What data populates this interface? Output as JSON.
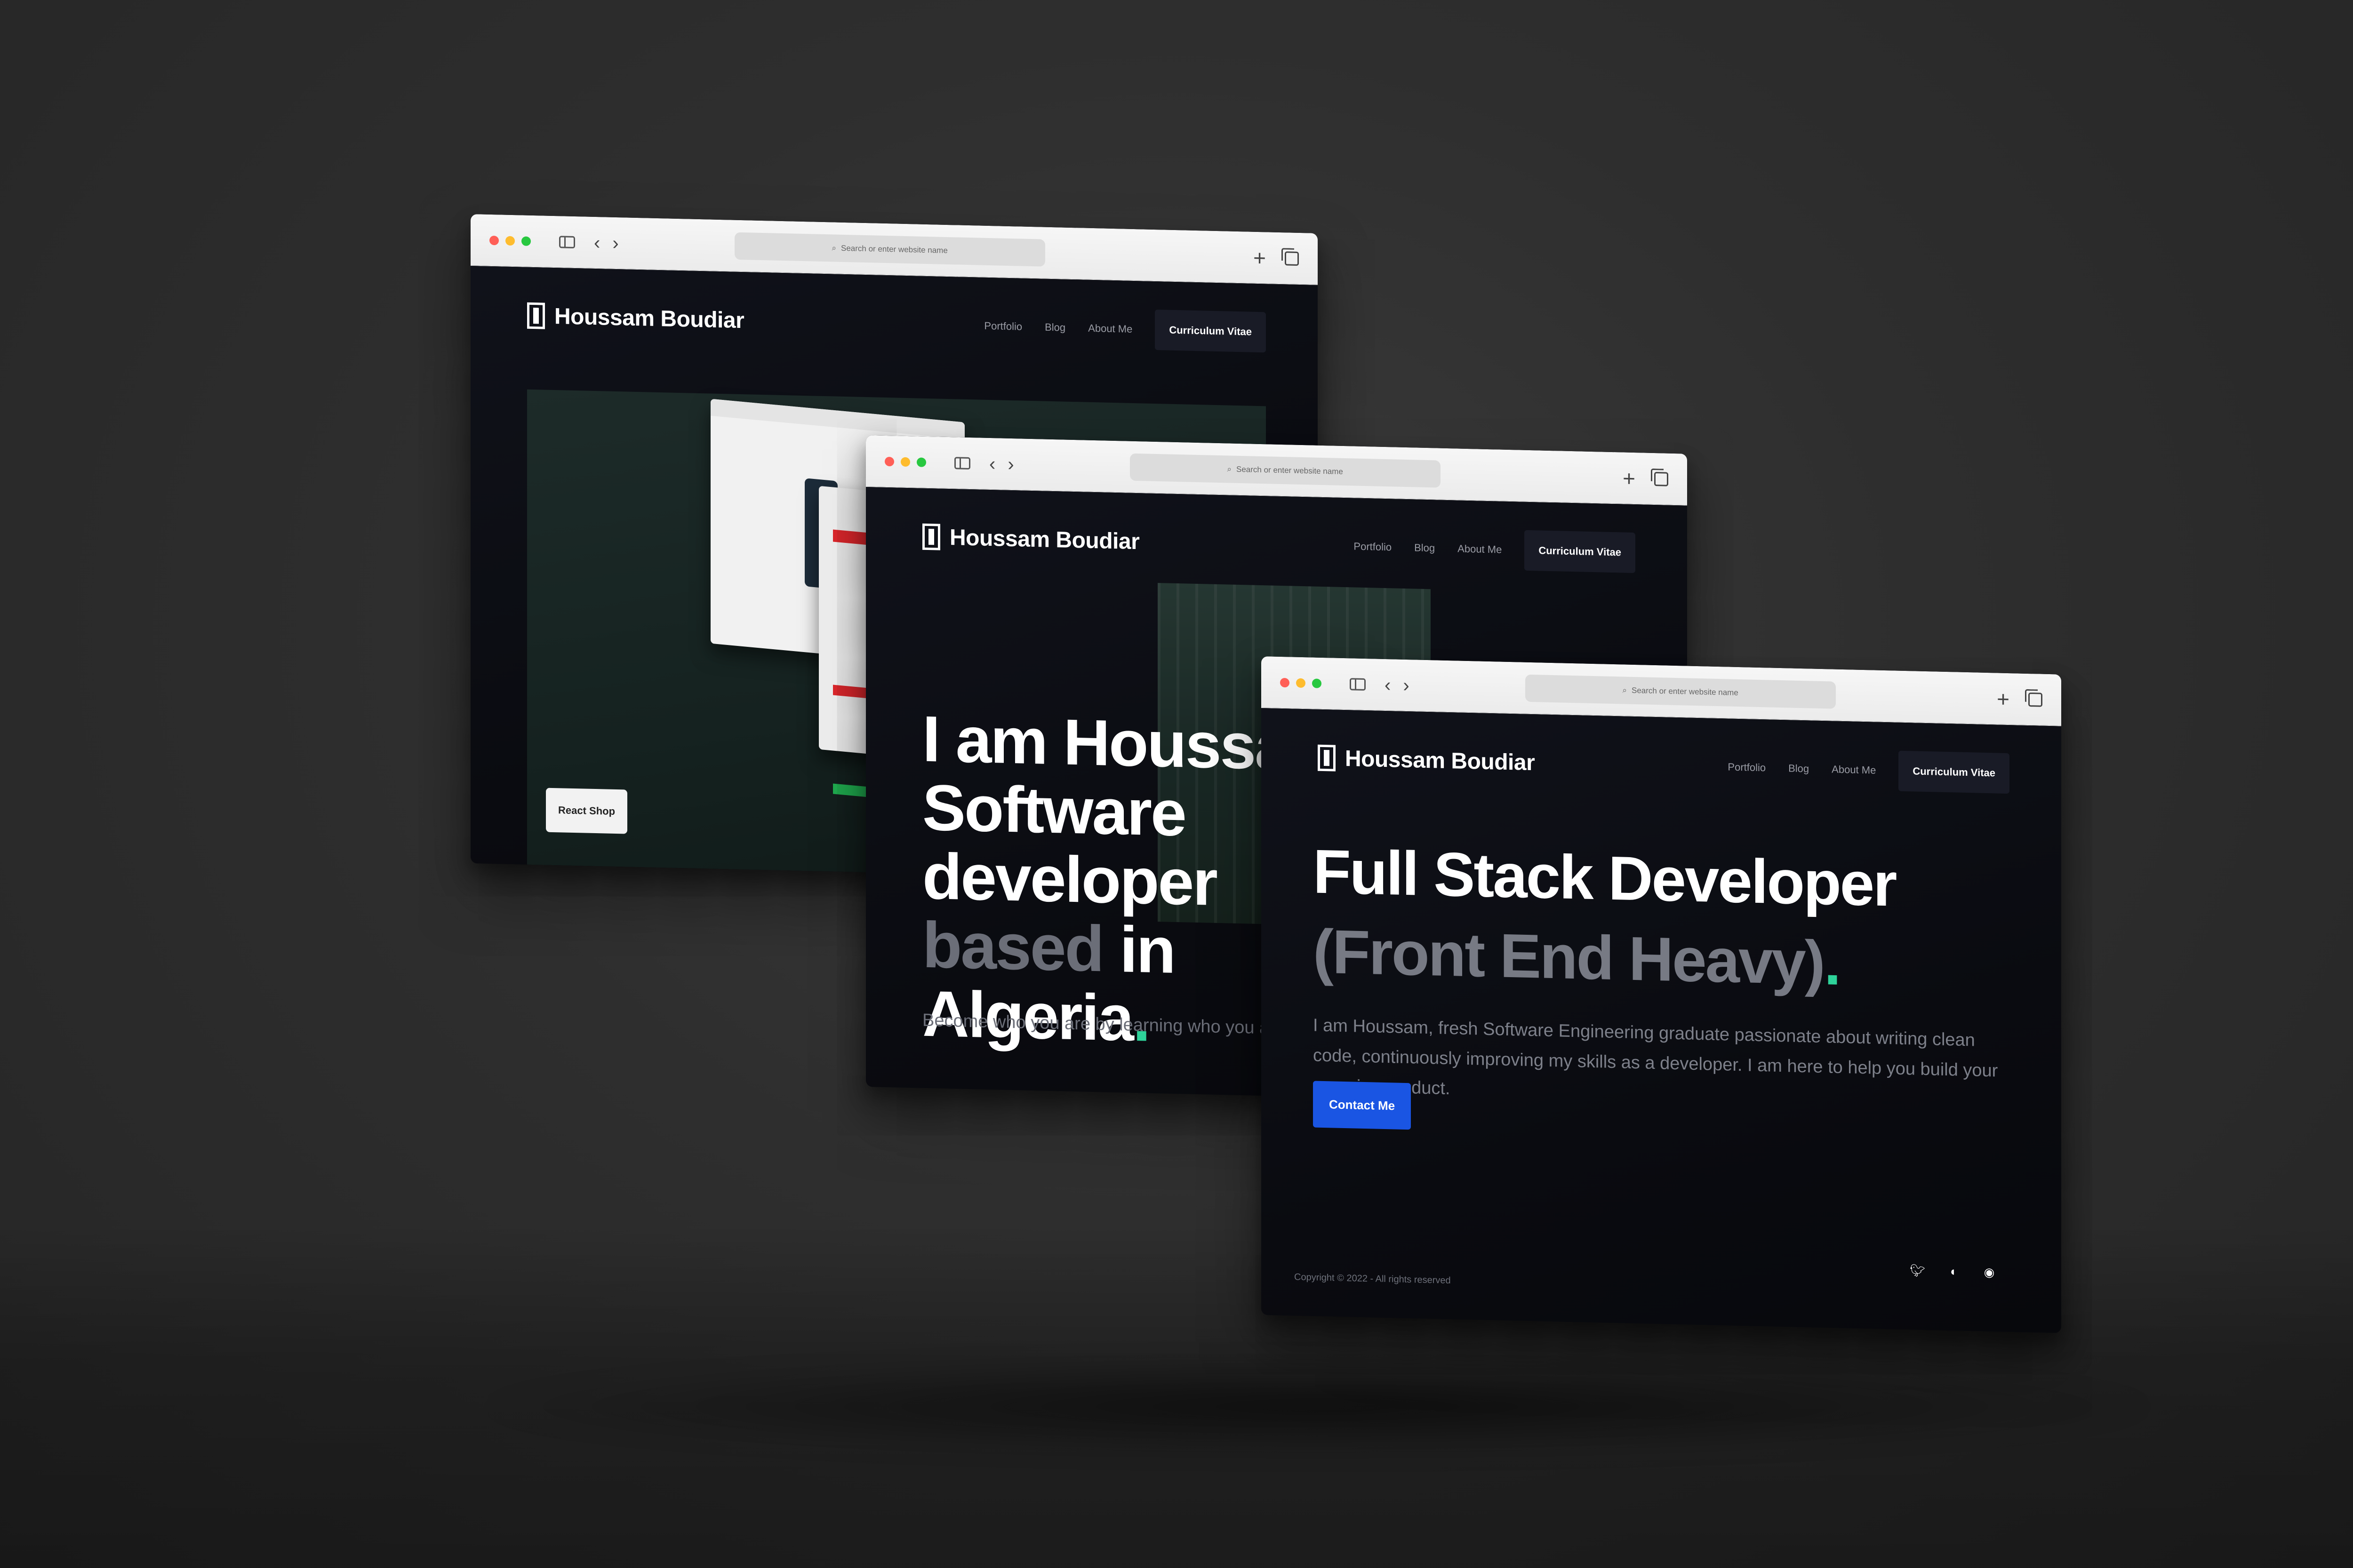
{
  "windows": [
    {
      "address_placeholder": "Search or enter website name",
      "brand": "Houssam Boudiar",
      "nav": [
        "Portfolio",
        "Blog",
        "About Me"
      ],
      "cta": "Curriculum Vitae",
      "project_button": "React Shop"
    },
    {
      "address_placeholder": "Search or enter website name",
      "brand": "Houssam Boudiar",
      "nav": [
        "Portfolio",
        "Blog",
        "About Me"
      ],
      "cta": "Curriculum Vitae",
      "hero": {
        "line1": "I am Houssam",
        "line2": "Software",
        "line3": "developer",
        "line4_muted": "based",
        "line4_rest": " in",
        "line5": "Algeria",
        "accent_dot": "."
      },
      "subtitle": "Become who you are by learning who you are"
    },
    {
      "address_placeholder": "Search or enter website name",
      "brand": "Houssam Boudiar",
      "nav": [
        "Portfolio",
        "Blog",
        "About Me"
      ],
      "cta": "Curriculum Vitae",
      "heading_line1": "Full Stack Developer",
      "heading_line2": "(Front End Heavy)",
      "accent_dot": ".",
      "description": "I am Houssam, fresh Software Engineering graduate passionate about writing clean code, continuously improving my skills as a developer. I am here to help you build your amazing product.",
      "contact_button": "Contact Me",
      "copyright": "Copyright © 2022 - All rights reserved",
      "socials": [
        "twitter-icon",
        "github-icon",
        "discord-icon"
      ]
    }
  ],
  "colors": {
    "accent_green": "#2ed39a",
    "contact_blue": "#1a55e3",
    "site_bg": "#0b0c12"
  }
}
